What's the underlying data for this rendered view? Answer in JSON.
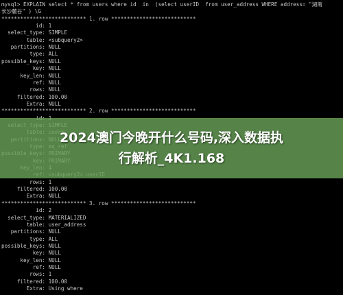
{
  "terminal": {
    "lines": [
      "mysql> EXPLAIN select * from users where id  in  (select userID  from user_address WHERE address= \"湖南",
      "长沙麓谷\" ) \\G",
      "*************************** 1. row ***************************",
      "           id: 1",
      "  select_type: SIMPLE",
      "        table: <subquery2>",
      "   partitions: NULL",
      "         type: ALL",
      "possible_keys: NULL",
      "          key: NULL",
      "      key_len: NULL",
      "          ref: NULL",
      "         rows: NULL",
      "     filtered: 100.00",
      "        Extra: NULL",
      "*************************** 2. row ***************************",
      "           id: 1",
      "  select_type: SIMPLE",
      "        table: users",
      "   partitions: NULL",
      "         type: eq_ref",
      "possible_keys: PRIMARY",
      "          key: PRIMARY",
      "      key_len: 4",
      "          ref: <subquery2>.userID",
      "         rows: 1",
      "     filtered: 100.00",
      "        Extra: NULL",
      "*************************** 3. row ***************************",
      "           id: 2",
      "  select_type: MATERIALIZED",
      "        table: user_address",
      "   partitions: NULL",
      "         type: ALL",
      "possible_keys: NULL",
      "          key: NULL",
      "      key_len: NULL",
      "          ref: NULL",
      "         rows: 1",
      "     filtered: 100.00",
      "        Extra: Using where"
    ]
  },
  "banner": {
    "line1": "2024澳门今晚开什么号码,深入数据执",
    "line2": "行解析_4K1.168",
    "color": "#68a058"
  }
}
